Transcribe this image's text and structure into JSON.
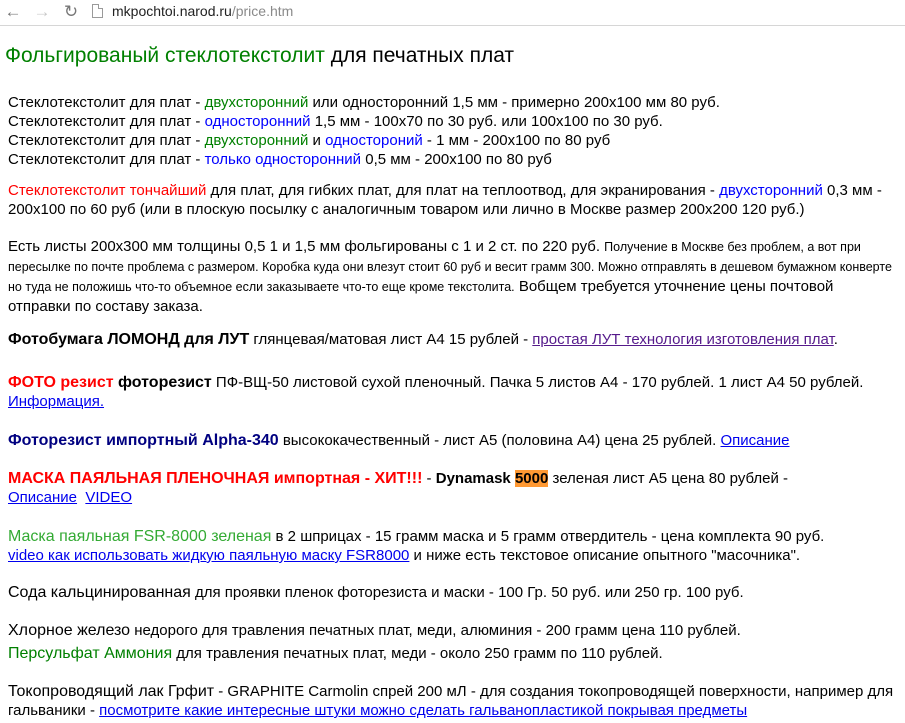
{
  "browser": {
    "url_host": "mkpochtoi.narod.ru",
    "url_path": "/price.htm"
  },
  "heading": {
    "part1": "Фольгированый стеклотекстолит",
    "part2": " для печатных плат"
  },
  "lines": {
    "l1": [
      "Стеклотекстолит для плат - ",
      "двухсторонний",
      " или односторонний 1,5 мм - примерно 200х100 мм 80 руб."
    ],
    "l2": [
      "Стеклотекстолит для плат - ",
      "односторонний",
      " 1,5 мм - 100х70 по 30 руб. или 100х100 по 30 руб."
    ],
    "l3": [
      "Стеклотекстолит для плат - ",
      "двухсторонний",
      " и ",
      "одностороний",
      " - 1 мм - 200х100 по 80 руб"
    ],
    "l4": [
      "Стеклотекстолит для плат - ",
      "только односторонний",
      " 0,5 мм - 200х100 по 80 руб"
    ]
  },
  "thin": {
    "red": "Стеклотекстолит тончайший",
    "t1": " для плат, для гибких плат, для плат на теплоотвод, для экранирования - ",
    "blue": "двухсторонний",
    "t2": " 0,3 мм - 200х100 по 60 руб (или в плоскую посылку с аналогичным товаром или лично в Москве  размер 200х200  120 руб.)"
  },
  "sheets": {
    "t1": "Есть листы 200х300 мм толщины 0,5  1 и 1,5 мм фольгированы с 1 и 2 ст. по 220 руб. ",
    "small": "Получение в Москве без проблем, а вот при пересылке по почте проблема с размером. Коробка куда они влезут стоит 60 руб и весит грамм 300. Можно отправлять в дешевом бумажном конверте но туда не положишь что-то объемное если заказываете что-то еще кроме текстолита.",
    "t2": " Вобщем требуется уточнение цены почтовой отправки по составу заказа."
  },
  "photopaper": {
    "bold": "Фотобумага ЛОМОНД для ЛУТ",
    "t1": " глянцевая/матовая лист А4 15 рублей - ",
    "link": "простая ЛУТ технология изготовления плат",
    "t2": "."
  },
  "photoresist": {
    "red": "ФОТО резист",
    "bold": " фоторезист",
    "t1": "  ПФ-ВЩ-50 листовой сухой пленочный.  Пачка 5 листов А4  - 170 рублей. 1 лист А4  50 рублей. ",
    "link": "Информация."
  },
  "alpha": {
    "bold": "Фоторезист импортный Alpha-340",
    "t1": " высококачественный - лист А5 (половина А4)  цена 25 рублей.  ",
    "link": "Описание"
  },
  "mask": {
    "red": "МАСКА ПАЯЛЬНАЯ ПЛЕНОЧНАЯ импортная - ХИТ!!!",
    "t1": " - ",
    "bold": "Dynamask ",
    "hl": "5000",
    "t2": " зеленая лист А5 цена 80 рублей -",
    "link1": "Описание",
    "link2": "VIDEO"
  },
  "fsr": {
    "green": "Маска паяльная FSR-8000 зеленая",
    "t1": " в 2 шприцах - 15 грамм маска и 5 грамм отвердитель  - цена комплекта 90 руб.",
    "link": "video как использовать жидкую паяльную маску FSR8000",
    "t2": " и ниже есть текстовое описание опытного \"масочника\"."
  },
  "soda": {
    "big": "Сода кальцинированная",
    "t1": " для проявки пленок фоторезиста и маски - 100 Гр. 50 руб. или  250 гр. 100 руб."
  },
  "ferric": {
    "big": "Хлорное железо",
    "t1": " недорого для травления печатных плат, меди, алюминия - 200 грамм цена 110 рублей."
  },
  "persulfate": {
    "green": "Персульфат Аммония",
    "t1": " для травления печатных плат, меди -  около 250 грамм по 110 рублей."
  },
  "lacquer": {
    "big": "Токопроводящий лак Грфит",
    "t1": " - GRAPHITE Carmolin  спрей 200 мЛ - для создания токопроводящей поверхности, например для гальваники - ",
    "link": "посмотрите какие интересные штуки можно сделать гальванопластикой покрывая предметы"
  }
}
